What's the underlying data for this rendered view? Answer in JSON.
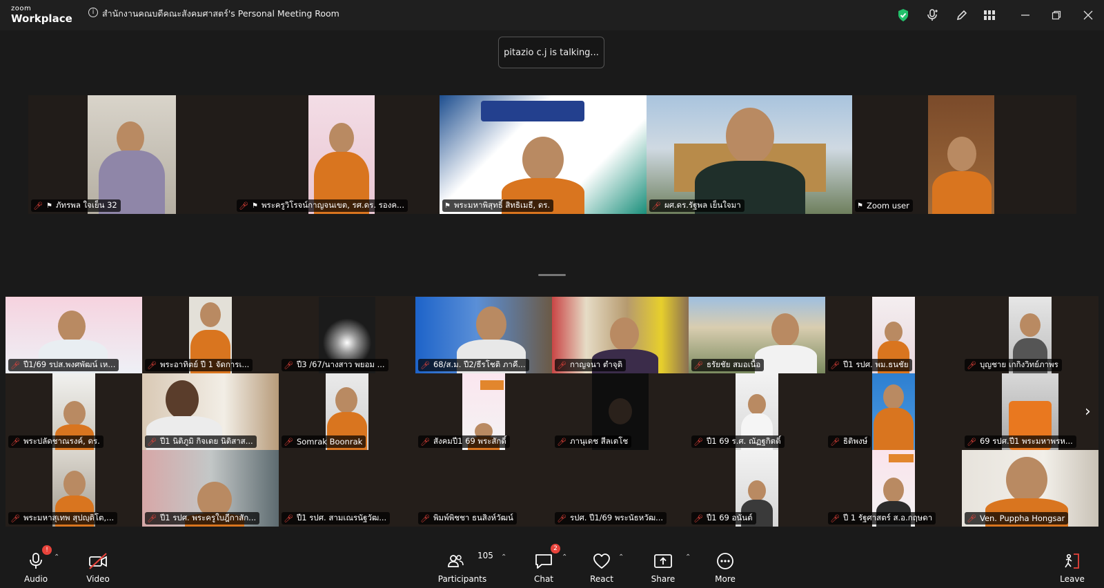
{
  "app": {
    "logo_line1": "zoom",
    "logo_line2": "Workplace"
  },
  "meeting": {
    "title": "สำนักงานคณบดีคณะสังคมศาสตร์'s Personal Meeting Room"
  },
  "toast": {
    "text": "pitazio c.j is talking..."
  },
  "top_row": [
    {
      "name": "ภัทรพล ใจเย็น 32",
      "muted": true,
      "pinned": true
    },
    {
      "name": "พระครูวิโรจน์กาญจนเขต, รศ.ดร. รองค...",
      "muted": true,
      "pinned": true
    },
    {
      "name": "พระมหาพิสุทธิ์ สิทธิเมธี, ดร.",
      "muted": false,
      "pinned": true
    },
    {
      "name": "ผศ.ดร.รัฐพล เย็นใจมา",
      "muted": true,
      "pinned": false
    },
    {
      "name": "Zoom user",
      "muted": false,
      "pinned": true
    }
  ],
  "grid": [
    {
      "name": "ปี1/69 รปส.พงศพัฒน์ เห..."
    },
    {
      "name": "พระอาทิตย์ ปี 1 จัดการเ..."
    },
    {
      "name": "ปี3 /67/นางสาว พยอม ..."
    },
    {
      "name": "68/ส.ม. ปี2/ธีรโชติ ภาคี..."
    },
    {
      "name": "กาญจนา ตำจุติ"
    },
    {
      "name": "ธรัยชัย สมอเนื้อ"
    },
    {
      "name": "ปี1 รปศ. พม.ธนชัย"
    },
    {
      "name": "บุญชาย เกกิงวิทย์ภาพร"
    },
    {
      "name": "พระปลัดชาณรงค์, ดร."
    },
    {
      "name": "ปี1 นิติภูมิ กิจเดย นิติสาส..."
    },
    {
      "name": "Somrak Boonrak"
    },
    {
      "name": "สังคมปี1 69 พระสักดิ์"
    },
    {
      "name": "ภานุเดช สีลเตโช"
    },
    {
      "name": "ปี1 69 ร.ศ. ณัฏฐกิตติ์"
    },
    {
      "name": "ธิติพงษ์"
    },
    {
      "name": "69 รปศ.ปี1 พระมหาพรห..."
    },
    {
      "name": "พระมหาสุเทพ สุปญฺติโต,..."
    },
    {
      "name": "ปี1 รปศ. พระครูใบฎีกาสัก..."
    },
    {
      "name": "ปี1 รปศ. สามเณรนัฐวัฒ..."
    },
    {
      "name": "พิมพ์พิชชา ธนสิงห์วัฒน์"
    },
    {
      "name": "รปศ. ปี1/69 พระนัธหวัฒ..."
    },
    {
      "name": "ปี1 69 อนันต์"
    },
    {
      "name": "ปี 1 รัฐศาสตร์ ส.อ.กฤษดา"
    },
    {
      "name": "Ven. Puppha Hongsar"
    }
  ],
  "toolbar": {
    "audio": "Audio",
    "video": "Video",
    "participants": "Participants",
    "participants_count": "105",
    "chat": "Chat",
    "chat_badge": "2",
    "react": "React",
    "share": "Share",
    "more": "More",
    "leave": "Leave"
  },
  "colors": {
    "accent": "#0e72ed",
    "muted": "#e8433b",
    "shield": "#23c06b"
  }
}
